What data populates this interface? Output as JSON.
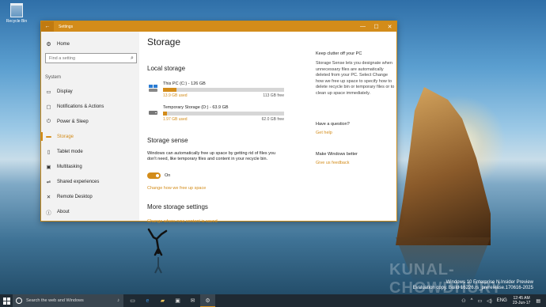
{
  "desktop": {
    "recycle_bin_label": "Recycle Bin",
    "watermark_text": "KUNAL-CHOWDHURY",
    "build_info": {
      "line1": "Windows 10 Enterprise N Insider Preview",
      "line2": "Evaluation copy. Build 16226.rs_prerelease.170616-2025"
    }
  },
  "window": {
    "title": "Settings",
    "back_glyph": "←",
    "minimize_glyph": "—",
    "maximize_glyph": "☐",
    "close_glyph": "✕"
  },
  "sidebar": {
    "home_label": "Home",
    "search_placeholder": "Find a setting",
    "section_title": "System",
    "items": [
      {
        "label": "Display",
        "icon": "display-icon",
        "glyph": "▭"
      },
      {
        "label": "Notifications & Actions",
        "icon": "notifications-icon",
        "glyph": "▢"
      },
      {
        "label": "Power & Sleep",
        "icon": "power-icon",
        "glyph": "⏻"
      },
      {
        "label": "Storage",
        "icon": "storage-icon",
        "glyph": "▬",
        "active": true
      },
      {
        "label": "Tablet mode",
        "icon": "tablet-icon",
        "glyph": "▯"
      },
      {
        "label": "Multitasking",
        "icon": "multitasking-icon",
        "glyph": "▣"
      },
      {
        "label": "Shared experiences",
        "icon": "shared-icon",
        "glyph": "⇌"
      },
      {
        "label": "Remote Desktop",
        "icon": "remote-icon",
        "glyph": "✕"
      },
      {
        "label": "About",
        "icon": "info-icon",
        "glyph": "ⓘ"
      }
    ]
  },
  "main": {
    "title": "Storage",
    "local_storage_heading": "Local storage",
    "drives": [
      {
        "name": "This PC (C:) - 126 GB",
        "used": "13.9 GB used",
        "free": "113 GB free",
        "used_fraction": 0.11
      },
      {
        "name": "Temporary Storage (D:) - 63.9 GB",
        "used": "1.97 GB used",
        "free": "62.0 GB free",
        "used_fraction": 0.03
      }
    ],
    "storage_sense_heading": "Storage sense",
    "storage_sense_text": "Windows can automatically free up space by getting rid of files you don't need, like temporary files and content in your recycle bin.",
    "toggle_state": "On",
    "change_free_link": "Change how we free up space",
    "more_heading": "More storage settings",
    "change_new_content_link": "Change where new content is saved"
  },
  "aside": {
    "clutter_heading": "Keep clutter off your PC",
    "clutter_text": "Storage Sense lets you designate when unnecessary files are automatically deleted from your PC. Select Change how we free up space to specify how to delete recycle bin or temporary files or to clean up space immediately.",
    "question_heading": "Have a question?",
    "get_help": "Get help",
    "better_heading": "Make Windows better",
    "feedback": "Give us feedback"
  },
  "taskbar": {
    "search_placeholder": "Search the web and Windows",
    "time": "12:45 AM",
    "date": "23-Jun-17",
    "language": "ENG",
    "accent": "#d38c1a"
  }
}
